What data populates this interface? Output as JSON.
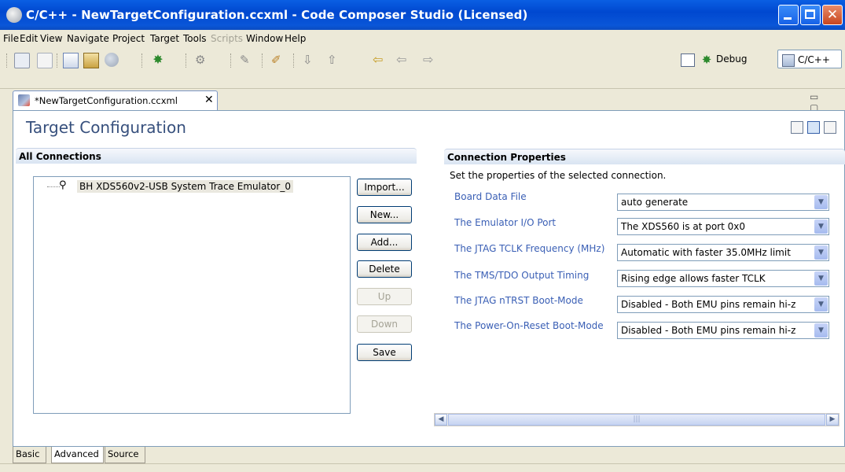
{
  "window": {
    "title": "C/C++ - NewTargetConfiguration.ccxml - Code Composer Studio (Licensed)",
    "close_glyph": "✕"
  },
  "menu": [
    "File",
    "Edit",
    "View",
    "Navigate",
    "Project",
    "Target",
    "Tools",
    "Scripts",
    "Window",
    "Help"
  ],
  "menu_disabled": [
    "Scripts"
  ],
  "perspectives": {
    "debug_label": "Debug",
    "cc_label": "C/C++"
  },
  "editor_tab": {
    "label": "*NewTargetConfiguration.ccxml",
    "close_glyph": "✕"
  },
  "editor": {
    "title": "Target Configuration",
    "all_connections": {
      "heading": "All Connections",
      "tree_item": "BH XDS560v2-USB System Trace Emulator_0"
    },
    "buttons": {
      "import": "Import...",
      "new": "New...",
      "add": "Add...",
      "delete": "Delete",
      "up": "Up",
      "down": "Down",
      "save": "Save"
    },
    "connection_properties": {
      "heading": "Connection Properties",
      "description": "Set the properties of the selected connection.",
      "rows": [
        {
          "label": "Board Data File",
          "value": "auto generate"
        },
        {
          "label": "The Emulator I/O Port",
          "value": "The XDS560 is at port 0x0"
        },
        {
          "label": "The JTAG TCLK Frequency (MHz)",
          "value": "Automatic with faster 35.0MHz limit"
        },
        {
          "label": "The TMS/TDO Output Timing",
          "value": "Rising edge allows faster TCLK"
        },
        {
          "label": "The JTAG nTRST Boot-Mode",
          "value": "Disabled - Both EMU pins remain hi-z"
        },
        {
          "label": "The Power-On-Reset Boot-Mode",
          "value": "Disabled - Both EMU pins remain hi-z"
        }
      ]
    }
  },
  "bottom_tabs": [
    "Basic",
    "Advanced",
    "Source"
  ],
  "active_bottom_tab": "Advanced",
  "icons": {
    "dropdown": "chevron-down-icon",
    "scroll_left": "scroll-left-icon",
    "scroll_right": "scroll-right-icon"
  }
}
